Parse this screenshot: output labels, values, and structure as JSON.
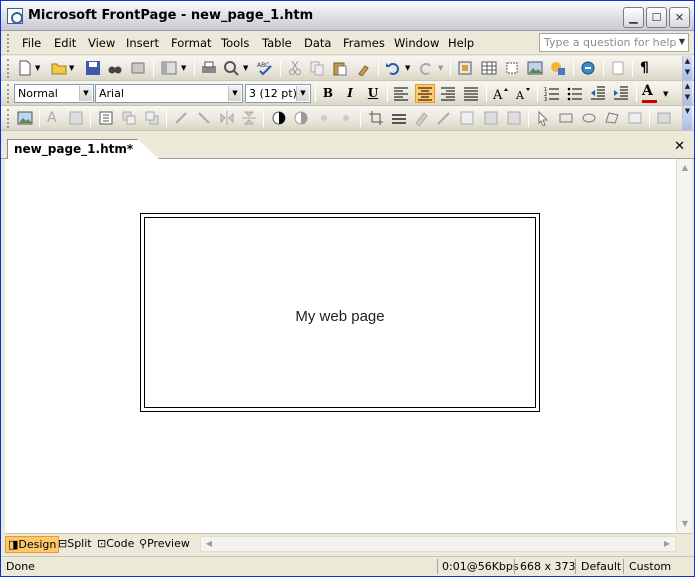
{
  "window": {
    "title": "Microsoft FrontPage - new_page_1.htm"
  },
  "menu": {
    "items": [
      "File",
      "Edit",
      "View",
      "Insert",
      "Format",
      "Tools",
      "Table",
      "Data",
      "Frames",
      "Window",
      "Help"
    ],
    "help_placeholder": "Type a question for help"
  },
  "formatting": {
    "style": "Normal",
    "font": "Arial",
    "size": "3 (12 pt)",
    "bold": "B",
    "italic": "I",
    "underline": "U"
  },
  "document": {
    "tab_label": "new_page_1.htm*",
    "body_text": "My web page"
  },
  "views": [
    "Design",
    "Split",
    "Code",
    "Preview"
  ],
  "status": {
    "message": "Done",
    "download_time": "0:01@56Kbps",
    "page_size": "668 x 373",
    "mode": "Default",
    "schema": "Custom"
  },
  "colors": {
    "active_button": "#ffc96b",
    "title_bar": "#e6e6ec",
    "font_color_bar": "#cc0000"
  },
  "icons": {
    "standard": [
      "new-page-icon",
      "open-icon",
      "save-icon",
      "search-icon",
      "publish-icon",
      "toggle-pane-icon",
      "print-icon",
      "preview-browser-icon",
      "spelling-icon",
      "cut-icon",
      "copy-icon",
      "paste-icon",
      "format-painter-icon",
      "undo-icon",
      "redo-icon",
      "web-component-icon",
      "insert-table-icon",
      "insert-layer-icon",
      "insert-picture-icon",
      "drawing-icon",
      "hyperlink-icon",
      "refresh-icon",
      "show-all-icon"
    ],
    "pictures": [
      "insert-picture-icon",
      "text-icon",
      "auto-thumbnail-icon",
      "bring-forward-icon",
      "send-backward-icon",
      "rotate-left-icon",
      "rotate-right-icon",
      "flip-horizontal-icon",
      "flip-vertical-icon",
      "more-contrast-icon",
      "less-contrast-icon",
      "more-brightness-icon",
      "less-brightness-icon",
      "crop-icon",
      "line-style-icon",
      "format-picture-icon",
      "set-transparent-icon",
      "color-icon",
      "bevel-icon",
      "resample-icon",
      "select-icon",
      "rectangle-icon",
      "circle-icon",
      "polygon-icon",
      "highlight-hotspots-icon",
      "restore-icon"
    ]
  }
}
